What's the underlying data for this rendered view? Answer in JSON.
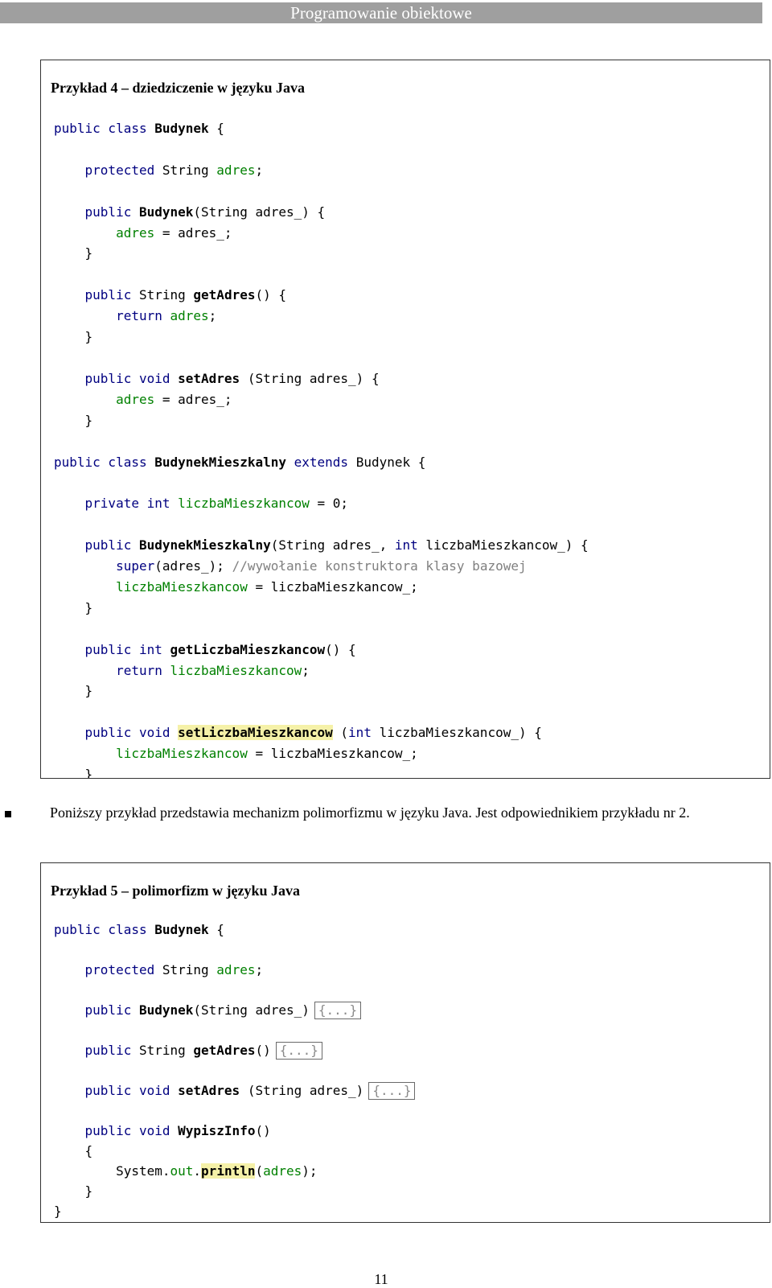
{
  "header": {
    "title": "Programowanie obiektowe"
  },
  "example4": {
    "title": "Przykład 4 – dziedziczenie w języku Java",
    "code": [
      [
        {
          "t": "public class ",
          "c": "kw"
        },
        {
          "t": "Budynek",
          "c": "plain bold"
        },
        {
          "t": " {",
          "c": "plain"
        }
      ],
      [],
      [
        {
          "t": "    protected ",
          "c": "kw"
        },
        {
          "t": "String ",
          "c": "plain"
        },
        {
          "t": "adres",
          "c": "fld"
        },
        {
          "t": ";",
          "c": "plain"
        }
      ],
      [],
      [
        {
          "t": "    public ",
          "c": "kw"
        },
        {
          "t": "Budynek",
          "c": "plain bold"
        },
        {
          "t": "(String adres_) {",
          "c": "plain"
        }
      ],
      [
        {
          "t": "        adres",
          "c": "fld"
        },
        {
          "t": " = adres_;",
          "c": "plain"
        }
      ],
      [
        {
          "t": "    }",
          "c": "plain"
        }
      ],
      [],
      [
        {
          "t": "    public ",
          "c": "kw"
        },
        {
          "t": "String ",
          "c": "plain"
        },
        {
          "t": "getAdres",
          "c": "plain bold"
        },
        {
          "t": "() {",
          "c": "plain"
        }
      ],
      [
        {
          "t": "        return ",
          "c": "kw"
        },
        {
          "t": "adres",
          "c": "fld"
        },
        {
          "t": ";",
          "c": "plain"
        }
      ],
      [
        {
          "t": "    }",
          "c": "plain"
        }
      ],
      [],
      [
        {
          "t": "    public void ",
          "c": "kw"
        },
        {
          "t": "setAdres",
          "c": "plain bold"
        },
        {
          "t": " (String adres_) {",
          "c": "plain"
        }
      ],
      [
        {
          "t": "        adres",
          "c": "fld"
        },
        {
          "t": " = adres_;",
          "c": "plain"
        }
      ],
      [
        {
          "t": "    }",
          "c": "plain"
        }
      ],
      [],
      [
        {
          "t": "public class ",
          "c": "kw"
        },
        {
          "t": "BudynekMieszkalny",
          "c": "plain bold"
        },
        {
          "t": " extends ",
          "c": "kw"
        },
        {
          "t": "Budynek {",
          "c": "plain"
        }
      ],
      [],
      [
        {
          "t": "    private int ",
          "c": "kw"
        },
        {
          "t": "liczbaMieszkancow",
          "c": "fld"
        },
        {
          "t": " = 0;",
          "c": "plain"
        }
      ],
      [],
      [
        {
          "t": "    public ",
          "c": "kw"
        },
        {
          "t": "BudynekMieszkalny",
          "c": "plain bold"
        },
        {
          "t": "(String adres_, ",
          "c": "plain"
        },
        {
          "t": "int ",
          "c": "kw"
        },
        {
          "t": "liczbaMieszkancow_) {",
          "c": "plain"
        }
      ],
      [
        {
          "t": "        super",
          "c": "kw"
        },
        {
          "t": "(adres_); ",
          "c": "plain"
        },
        {
          "t": "//wywołanie konstruktora klasy bazowej",
          "c": "cmt"
        }
      ],
      [
        {
          "t": "        liczbaMieszkancow",
          "c": "fld"
        },
        {
          "t": " = liczbaMieszkancow_;",
          "c": "plain"
        }
      ],
      [
        {
          "t": "    }",
          "c": "plain"
        }
      ],
      [],
      [
        {
          "t": "    public int ",
          "c": "kw"
        },
        {
          "t": "getLiczbaMieszkancow",
          "c": "plain bold"
        },
        {
          "t": "() {",
          "c": "plain"
        }
      ],
      [
        {
          "t": "        return ",
          "c": "kw"
        },
        {
          "t": "liczbaMieszkancow",
          "c": "fld"
        },
        {
          "t": ";",
          "c": "plain"
        }
      ],
      [
        {
          "t": "    }",
          "c": "plain"
        }
      ],
      [],
      [
        {
          "t": "    public void ",
          "c": "kw"
        },
        {
          "t": "setLiczbaMieszkancow",
          "c": "plain bold hl"
        },
        {
          "t": " (",
          "c": "plain"
        },
        {
          "t": "int ",
          "c": "kw"
        },
        {
          "t": "liczbaMieszkancow_) {",
          "c": "plain"
        }
      ],
      [
        {
          "t": "        liczbaMieszkancow",
          "c": "fld"
        },
        {
          "t": " = liczbaMieszkancow_;",
          "c": "plain"
        }
      ],
      [
        {
          "t": "    }",
          "c": "plain"
        }
      ]
    ]
  },
  "paragraph": {
    "text": "Poniższy przykład przedstawia mechanizm polimorfizmu w języku Java. Jest odpowiednikiem przykładu nr 2."
  },
  "example5": {
    "title": "Przykład 5 – polimorfizm w języku Java",
    "code": [
      [
        {
          "t": "public class ",
          "c": "kw"
        },
        {
          "t": "Budynek",
          "c": "plain bold"
        },
        {
          "t": " {",
          "c": "plain"
        }
      ],
      [],
      [
        {
          "t": "    protected ",
          "c": "kw"
        },
        {
          "t": "String ",
          "c": "plain"
        },
        {
          "t": "adres",
          "c": "fld"
        },
        {
          "t": ";",
          "c": "plain"
        }
      ],
      [],
      [
        {
          "t": "    public ",
          "c": "kw"
        },
        {
          "t": "Budynek",
          "c": "plain bold"
        },
        {
          "t": "(String adres_)",
          "c": "plain"
        },
        {
          "t": "{...}",
          "c": "collapsed"
        }
      ],
      [],
      [
        {
          "t": "    public ",
          "c": "kw"
        },
        {
          "t": "String ",
          "c": "plain"
        },
        {
          "t": "getAdres",
          "c": "plain bold"
        },
        {
          "t": "()",
          "c": "plain"
        },
        {
          "t": "{...}",
          "c": "collapsed"
        }
      ],
      [],
      [
        {
          "t": "    public void ",
          "c": "kw"
        },
        {
          "t": "setAdres",
          "c": "plain bold"
        },
        {
          "t": " (String adres_)",
          "c": "plain"
        },
        {
          "t": "{...}",
          "c": "collapsed"
        }
      ],
      [],
      [
        {
          "t": "    public void ",
          "c": "kw"
        },
        {
          "t": "WypiszInfo",
          "c": "plain bold"
        },
        {
          "t": "()",
          "c": "plain"
        }
      ],
      [
        {
          "t": "    {",
          "c": "plain"
        }
      ],
      [
        {
          "t": "        System.",
          "c": "plain"
        },
        {
          "t": "out",
          "c": "fld"
        },
        {
          "t": ".",
          "c": "plain"
        },
        {
          "t": "println",
          "c": "plain bold hl"
        },
        {
          "t": "(",
          "c": "plain"
        },
        {
          "t": "adres",
          "c": "fld"
        },
        {
          "t": ");",
          "c": "plain"
        }
      ],
      [
        {
          "t": "    }",
          "c": "plain"
        }
      ],
      [
        {
          "t": "}",
          "c": "plain"
        }
      ]
    ]
  },
  "page_number": "11"
}
